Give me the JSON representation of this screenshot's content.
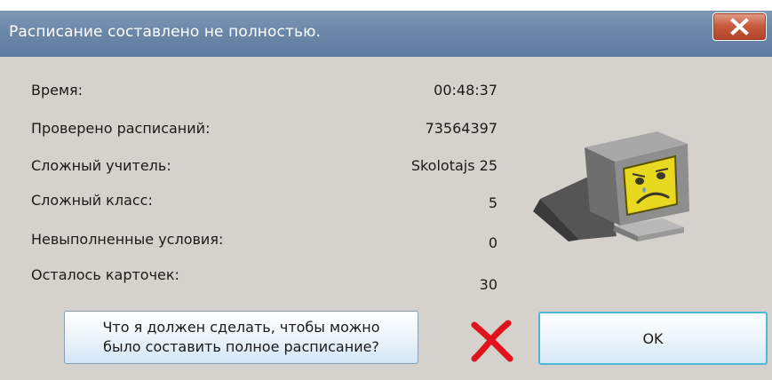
{
  "window": {
    "title": "Расписание составлено не полностью."
  },
  "stats": [
    {
      "label": "Время:",
      "value": "00:48:37"
    },
    {
      "label": "Проверено расписаний:",
      "value": "73564397"
    },
    {
      "label": "Сложный учитель:",
      "value": "Skolotajs 25"
    },
    {
      "label": "Сложный класс:",
      "value": "5"
    },
    {
      "label": "Невыполненные условия:",
      "value": "0"
    },
    {
      "label": "Осталось карточек:",
      "value": "30"
    }
  ],
  "buttons": {
    "help_line1": "Что я должен сделать, чтобы можно",
    "help_line2": "было составить полное расписание?",
    "ok": "OK"
  },
  "icons": {
    "close": "close-icon",
    "sad_computer": "sad-computer-icon",
    "red_x": "red-x-icon"
  },
  "colors": {
    "titlebar": "#6a86a8",
    "close_button": "#c85b3f",
    "dialog_bg": "#d5d2cd",
    "ok_border": "#4fb6d6",
    "red_x": "#e0131a"
  }
}
